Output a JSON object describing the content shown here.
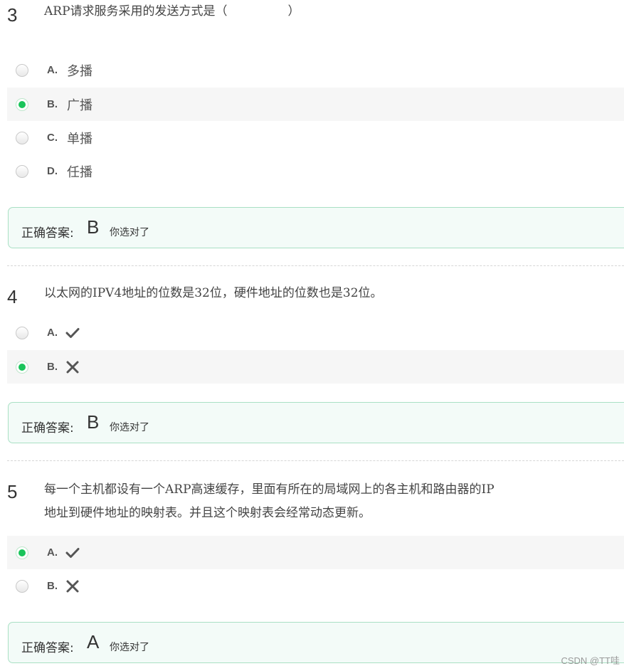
{
  "questions": [
    {
      "number": "3",
      "text": "ARP请求服务采用的发送方式是（　　　　　）",
      "options": [
        {
          "letter": "A.",
          "text": "多播",
          "selected": false
        },
        {
          "letter": "B.",
          "text": "广播",
          "selected": true
        },
        {
          "letter": "C.",
          "text": "单播",
          "selected": false
        },
        {
          "letter": "D.",
          "text": "任播",
          "selected": false
        }
      ],
      "answer_label": "正确答案:",
      "answer_value": "B",
      "answer_note": "你选对了"
    },
    {
      "number": "4",
      "text": "以太网的IPV4地址的位数是32位，硬件地址的位数也是32位。",
      "options": [
        {
          "letter": "A.",
          "icon": "check-icon",
          "selected": false
        },
        {
          "letter": "B.",
          "icon": "cross-icon",
          "selected": true
        }
      ],
      "answer_label": "正确答案:",
      "answer_value": "B",
      "answer_note": "你选对了"
    },
    {
      "number": "5",
      "text_line1": "每一个主机都设有一个ARP高速缓存，里面有所在的局域网上的各主机和路由器的IP",
      "text_line2": "地址到硬件地址的映射表。并且这个映射表会经常动态更新。",
      "options": [
        {
          "letter": "A.",
          "icon": "check-icon",
          "selected": true
        },
        {
          "letter": "B.",
          "icon": "cross-icon",
          "selected": false
        }
      ],
      "answer_label": "正确答案:",
      "answer_value": "A",
      "answer_note": "你选对了"
    }
  ],
  "colors": {
    "selected_radio": "#19c45a",
    "answer_border": "#a9e0c4",
    "answer_bg": "#f3fbf8"
  },
  "watermark": "CSDN @TT哇"
}
